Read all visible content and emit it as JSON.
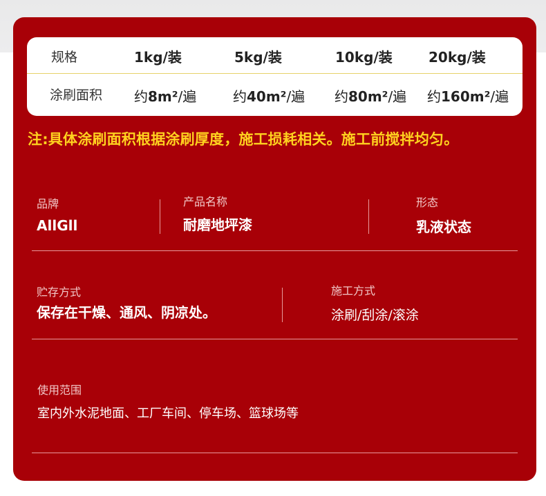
{
  "spec_table": {
    "header_row": {
      "label": "规格",
      "sizes": [
        "1kg/装",
        "5kg/装",
        "10kg/装",
        "20kg/装"
      ]
    },
    "area_row": {
      "label": "涂刷面积",
      "prefix": "约",
      "numbers": [
        "8m²",
        "40m²",
        "80m²",
        "160m²"
      ],
      "suffix": "/遍"
    }
  },
  "note": "注:具体涂刷面积根据涂刷厚度，施工损耗相关。施工前搅拌均匀。",
  "product_info": {
    "brand": {
      "label": "品牌",
      "value": "AllGll"
    },
    "name": {
      "label": "产品名称",
      "value": "耐磨地坪漆"
    },
    "form": {
      "label": "形态",
      "value": "乳液状态"
    },
    "storage": {
      "label": "贮存方式",
      "value": "保存在干燥、通风、阴凉处。"
    },
    "application": {
      "label": "施工方式",
      "value": "涂刷/刮涂/滚涂"
    },
    "usage": {
      "label": "使用范围",
      "value": "室内外水泥地面、工厂车间、停车场、篮球场等"
    }
  },
  "colors": {
    "card_background": "#a80007",
    "note_text": "#ffd21f",
    "table_divider": "#e6d168"
  }
}
